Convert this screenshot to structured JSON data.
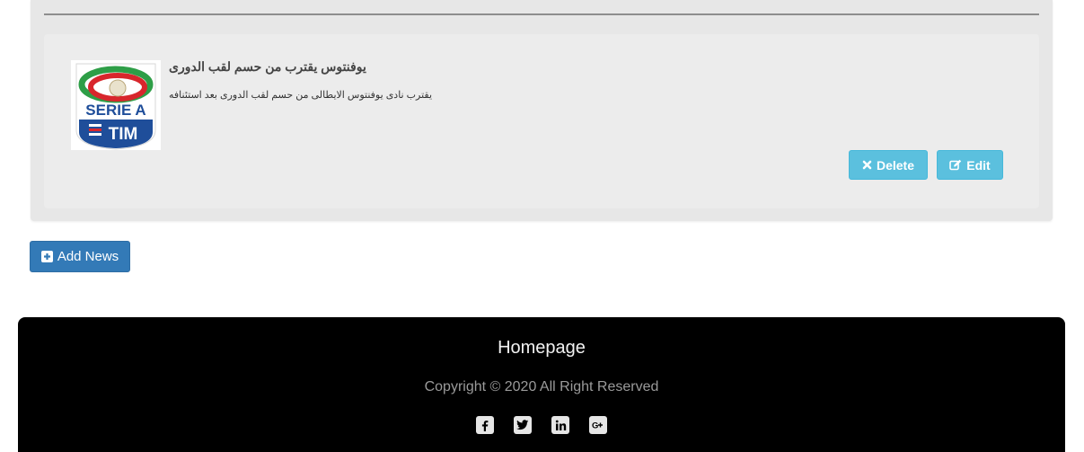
{
  "news": {
    "title": "يوفنتوس يقترب من حسم لقب الدورى",
    "body": "يقترب نادى يوفنتوس الايطالى من حسم لقب الدورى بعد استئنافه",
    "logo": {
      "line1": "SERIE A",
      "line2": "TIM"
    },
    "delete_label": "Delete",
    "edit_label": "Edit"
  },
  "actions": {
    "add_news_label": "Add News"
  },
  "footer": {
    "home_link": "Homepage",
    "copyright": "Copyright © 2020 All Right Reserved",
    "social": [
      {
        "icon": "facebook-icon",
        "glyph": "f"
      },
      {
        "icon": "twitter-icon",
        "glyph": "t"
      },
      {
        "icon": "linkedin-icon",
        "glyph": "in"
      },
      {
        "icon": "google-plus-icon",
        "glyph": "G+"
      }
    ]
  },
  "colors": {
    "info": "#5bc0de",
    "primary": "#337ab7",
    "footer_bg": "#000000"
  }
}
